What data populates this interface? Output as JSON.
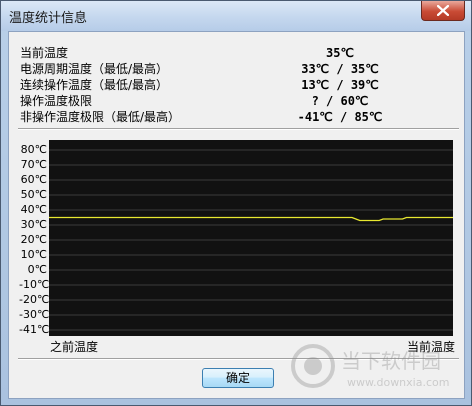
{
  "window": {
    "title": "温度统计信息"
  },
  "info": [
    {
      "label": "当前温度",
      "value": "35℃"
    },
    {
      "label": "电源周期温度（最低/最高）",
      "value": "33℃ / 35℃"
    },
    {
      "label": "连续操作温度（最低/最高）",
      "value": "13℃ / 39℃"
    },
    {
      "label": "操作温度极限",
      "value": "? / 60℃"
    },
    {
      "label": "非操作温度极限（最低/最高）",
      "value": "-41℃ / 85℃"
    }
  ],
  "chart_data": {
    "type": "line",
    "ylim": [
      -41,
      85
    ],
    "yticks": [
      "80℃",
      "70℃",
      "60℃",
      "50℃",
      "40℃",
      "30℃",
      "20℃",
      "10℃",
      "0℃",
      "-10℃",
      "-20℃",
      "-30℃",
      "-41℃"
    ],
    "xlabel_left": "之前温度",
    "xlabel_right": "当前温度",
    "grid": true,
    "line_color": "#e8e830",
    "series": [
      {
        "values": [
          35,
          35,
          35,
          35,
          35,
          35,
          35,
          35,
          35,
          35,
          35,
          35,
          35,
          35,
          35,
          35,
          35,
          35,
          35,
          35,
          35,
          35,
          35,
          35,
          35,
          35,
          35,
          35,
          35,
          35,
          35,
          35,
          35,
          35,
          35,
          35,
          35,
          35,
          35,
          35,
          35,
          35,
          35,
          35,
          35,
          35,
          35,
          35,
          35,
          35,
          35,
          35,
          35,
          35,
          35,
          35,
          35,
          35,
          35,
          35,
          35,
          35,
          35,
          35,
          35,
          35,
          35,
          35,
          35,
          35,
          35,
          35,
          35,
          35,
          35,
          35,
          35,
          35,
          35,
          34,
          33,
          33,
          33,
          33,
          33,
          33,
          34,
          34,
          34,
          34,
          34,
          34,
          35,
          35,
          35,
          35,
          35,
          35,
          35,
          35,
          35,
          35,
          35,
          35,
          35
        ]
      }
    ]
  },
  "buttons": {
    "ok": "确定"
  },
  "watermark": {
    "brand": "当下软件园",
    "url": "www.downxia.com"
  }
}
